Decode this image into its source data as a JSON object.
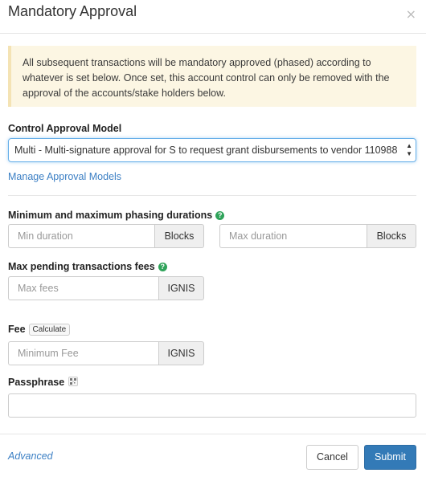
{
  "modal": {
    "title": "Mandatory Approval",
    "close_glyph": "×"
  },
  "alert": {
    "text": "All subsequent transactions will be mandatory approved (phased) according to whatever is set below. Once set, this account control can only be removed with the approval of the accounts/stake holders below."
  },
  "control_model": {
    "label": "Control Approval Model",
    "selected": "Multi - Multi-signature approval for S to request grant disbursements to vendor 110988",
    "manage_link": "Manage Approval Models"
  },
  "phasing": {
    "label": "Minimum and maximum phasing durations",
    "min_placeholder": "Min duration",
    "min_unit": "Blocks",
    "max_placeholder": "Max duration",
    "max_unit": "Blocks"
  },
  "max_fees": {
    "label": "Max pending transactions fees",
    "placeholder": "Max fees",
    "unit": "IGNIS"
  },
  "fee": {
    "label": "Fee",
    "calculate_label": "Calculate",
    "placeholder": "Minimum Fee",
    "unit": "IGNIS"
  },
  "passphrase": {
    "label": "Passphrase",
    "value": ""
  },
  "footer": {
    "advanced_label": "Advanced",
    "cancel_label": "Cancel",
    "submit_label": "Submit"
  },
  "colors": {
    "link": "#3b7fc4",
    "primary": "#337ab7",
    "alert_bg": "#fcf6e3",
    "help_icon": "#2fa35a"
  },
  "icons": [
    "close-icon",
    "help-icon",
    "select-arrows-icon",
    "qr-code-icon"
  ]
}
